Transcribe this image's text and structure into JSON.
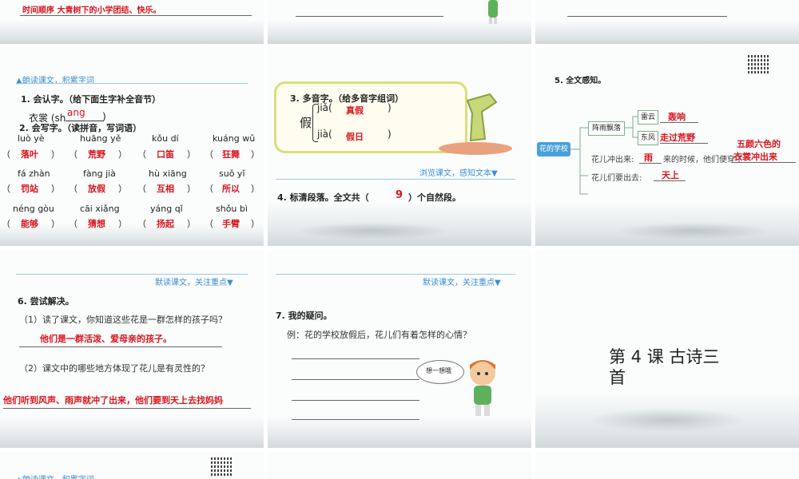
{
  "row1": {
    "s1_text": "时间顺序  大青树下的小学团结、快乐。"
  },
  "s4": {
    "header": "▲朗读课文，积累字词",
    "q1": "1.   会认字。（给下面生字补全音节）",
    "q1_word": "衣裳 (sh",
    "q1_answer": "ang",
    "q1_close": ")",
    "q2": "2. 会写字。（读拼音，写词语）",
    "pinyin": [
      [
        "luò yè",
        "huāng yě",
        "kǒu dí",
        "kuáng wǔ"
      ],
      [
        "fá zhàn",
        "fàng jià",
        "hù xiāng",
        "suǒ yǐ"
      ],
      [
        "néng gòu",
        "cāi xiǎng",
        "yáng qǐ",
        "shǒu bì"
      ]
    ],
    "answers": [
      [
        "落叶",
        "荒野",
        "口笛",
        "狂舞"
      ],
      [
        "罚站",
        "放假",
        "互相",
        "所以"
      ],
      [
        "能够",
        "猜想",
        "扬起",
        "手臂"
      ]
    ],
    "paren_open": "（",
    "paren_close": "）"
  },
  "s5": {
    "q3": "3.  多音字。（给多音字组词）",
    "char": "假",
    "r1": "jiǎ(",
    "r1_ans": "真假",
    "r2": "jià(",
    "r2_ans": "假日",
    "close": ")",
    "nav": "浏览课文，感知文本▼",
    "q4a": "4. 标清段落。全文共（",
    "q4_ans": "9",
    "q4b": "）个自然段。"
  },
  "s6": {
    "q5": "5.  全文感知。",
    "center": "花的学校",
    "zhenyu": "阵雨飘落",
    "leiyun": "雷云",
    "dongfeng": "东风",
    "ans_hong": "轰响",
    "ans_zou": "走过荒野",
    "line1a": "花儿冲出来:",
    "ans_yu": "雨",
    "line1b": "来的时候，他们便穿了",
    "ans_yishang": "五颜六色的",
    "ans_yishang2": "衣裳冲出来",
    "line2": "花儿们要出去:",
    "ans_tian": "天上"
  },
  "s7": {
    "nav": "默读课文，关注重点▼",
    "q6": "6.  尝试解决。",
    "q6a": "（1）读了课文，你知道这些花是一群怎样的孩子吗？",
    "a6a": "他们是一群活泼、爱母亲的孩子。",
    "q6b": "（2）课文中的哪些地方体现了花儿是有灵性的？",
    "a6b": "他们听到风声、雨声就冲了出来，他们要到天上去找妈妈"
  },
  "s8": {
    "nav": "默读课文，关注重点▼",
    "q7": "7.  我的疑问。",
    "example": "例：花的学校放假后，花儿们有着怎样的心情？",
    "bubble": "想一想哦"
  },
  "s9": {
    "title_line1": "第 4 课  古诗三",
    "title_line2": "首"
  },
  "row4": {
    "s10_header": "▲朗读课文，积累字词"
  }
}
